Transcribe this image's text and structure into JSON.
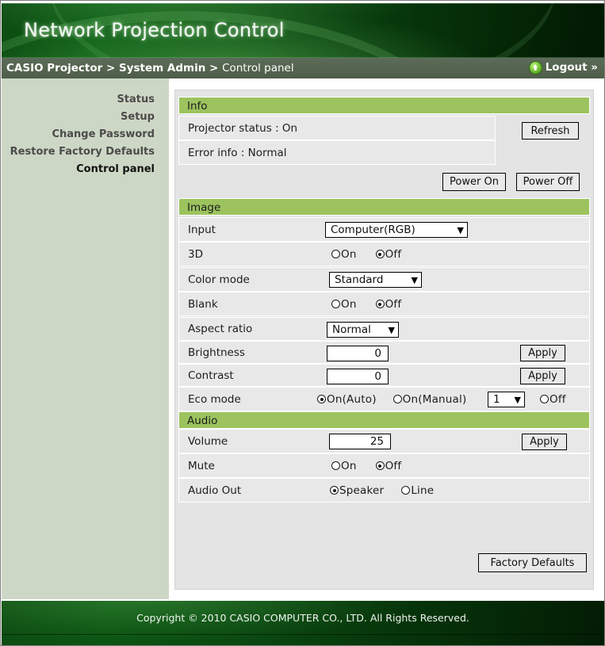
{
  "banner": {
    "title": "Network Projection Control"
  },
  "breadcrumb": {
    "trail": "CASIO Projector > System Admin > ",
    "current": "Control panel",
    "logout_label": "Logout »",
    "logout_icon": "up-arrow-circle-icon"
  },
  "sidebar": {
    "items": [
      {
        "label": "Status",
        "active": false
      },
      {
        "label": "Setup",
        "active": false
      },
      {
        "label": "Change Password",
        "active": false
      },
      {
        "label": "Restore Factory Defaults",
        "active": false
      },
      {
        "label": "Control panel",
        "active": true
      }
    ]
  },
  "sections": {
    "info": {
      "title": "Info",
      "projector_status": "Projector status : On",
      "error_info": "Error info : Normal",
      "refresh_label": "Refresh",
      "power_on_label": "Power On",
      "power_off_label": "Power Off"
    },
    "image": {
      "title": "Image",
      "input": {
        "label": "Input",
        "value": "Computer(RGB)"
      },
      "threed": {
        "label": "3D",
        "on_label": "On",
        "off_label": "Off",
        "selected": "Off"
      },
      "color_mode": {
        "label": "Color mode",
        "value": "Standard"
      },
      "blank": {
        "label": "Blank",
        "on_label": "On",
        "off_label": "Off",
        "selected": "Off"
      },
      "aspect_ratio": {
        "label": "Aspect ratio",
        "value": "Normal"
      },
      "brightness": {
        "label": "Brightness",
        "value": "0",
        "apply_label": "Apply"
      },
      "contrast": {
        "label": "Contrast",
        "value": "0",
        "apply_label": "Apply"
      },
      "eco_mode": {
        "label": "Eco mode",
        "auto_label": "On(Auto)",
        "manual_label": "On(Manual)",
        "manual_level": "1",
        "off_label": "Off",
        "selected": "On(Auto)"
      }
    },
    "audio": {
      "title": "Audio",
      "volume": {
        "label": "Volume",
        "value": "25",
        "apply_label": "Apply"
      },
      "mute": {
        "label": "Mute",
        "on_label": "On",
        "off_label": "Off",
        "selected": "Off"
      },
      "audio_out": {
        "label": "Audio Out",
        "speaker_label": "Speaker",
        "line_label": "Line",
        "selected": "Speaker"
      }
    },
    "factory_defaults_label": "Factory Defaults"
  },
  "footer": {
    "copyright": "Copyright © 2010 CASIO COMPUTER CO., LTD. All Rights Reserved."
  },
  "colors": {
    "section_header_green": "#9cc35e",
    "sidebar_bg": "#cdd7c5",
    "content_bg": "#e4e4e4",
    "banner_green": "#0a4e11",
    "crumb_bar": "#55654f"
  }
}
